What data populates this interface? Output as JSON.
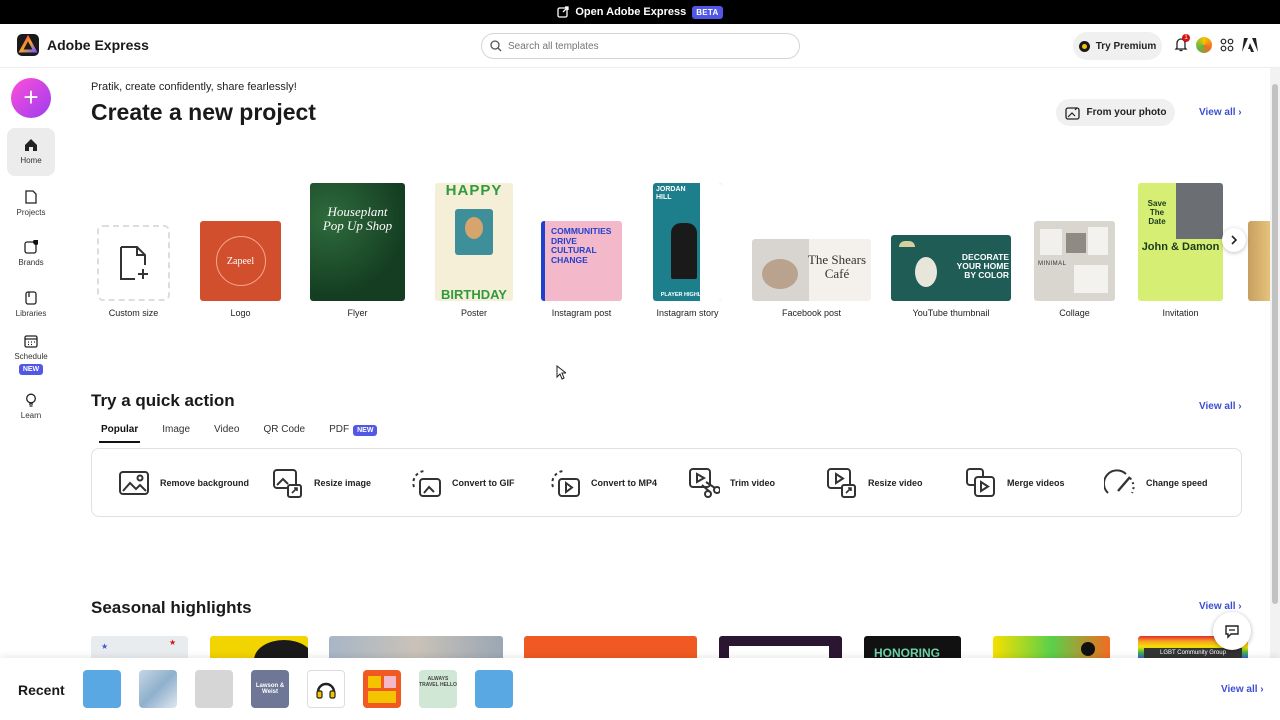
{
  "banner": {
    "text": "Open Adobe Express",
    "badge": "BETA"
  },
  "header": {
    "app_name": "Adobe Express",
    "search_placeholder": "Search all templates",
    "premium_label": "Try Premium",
    "notification_count": "1"
  },
  "sidebar": {
    "items": [
      {
        "label": "Home"
      },
      {
        "label": "Projects"
      },
      {
        "label": "Brands"
      },
      {
        "label": "Libraries"
      },
      {
        "label": "Schedule",
        "badge": "NEW"
      },
      {
        "label": "Learn"
      }
    ]
  },
  "main": {
    "greeting": "Pratik, create confidently, share fearlessly!",
    "title": "Create a new project",
    "from_photo_label": "From your photo",
    "view_all": "View all",
    "templates": [
      {
        "label": "Custom size"
      },
      {
        "label": "Logo",
        "thumb_text": "Zapeel"
      },
      {
        "label": "Flyer",
        "thumb_text": "Houseplant Pop Up Shop"
      },
      {
        "label": "Poster",
        "thumb_text_top": "HAPPY",
        "thumb_text_bottom": "BIRTHDAY"
      },
      {
        "label": "Instagram post",
        "thumb_text": "COMMUNITIES DRIVE CULTURAL CHANGE"
      },
      {
        "label": "Instagram story",
        "thumb_text": "JORDAN HILL",
        "thumb_text_bottom": "PLAYER HIGHLIGHT"
      },
      {
        "label": "Facebook post",
        "thumb_text": "The Shears Café"
      },
      {
        "label": "YouTube thumbnail",
        "thumb_text": "DECORATE YOUR HOME BY COLOR"
      },
      {
        "label": "Collage",
        "thumb_text": "MINIMAL"
      },
      {
        "label": "Invitation",
        "thumb_text_top": "Save The Date",
        "thumb_text": "John & Damon"
      }
    ]
  },
  "quick_actions": {
    "title": "Try a quick action",
    "view_all": "View all",
    "tabs": [
      {
        "label": "Popular"
      },
      {
        "label": "Image"
      },
      {
        "label": "Video"
      },
      {
        "label": "QR Code"
      },
      {
        "label": "PDF",
        "badge": "NEW"
      }
    ],
    "actions": [
      {
        "label": "Remove background",
        "icon": "remove-background-icon"
      },
      {
        "label": "Resize image",
        "icon": "resize-image-icon"
      },
      {
        "label": "Convert to GIF",
        "icon": "convert-gif-icon"
      },
      {
        "label": "Convert to MP4",
        "icon": "convert-mp4-icon"
      },
      {
        "label": "Trim video",
        "icon": "trim-video-icon"
      },
      {
        "label": "Resize video",
        "icon": "resize-video-icon"
      },
      {
        "label": "Merge videos",
        "icon": "merge-videos-icon"
      },
      {
        "label": "Change speed",
        "icon": "change-speed-icon"
      }
    ]
  },
  "seasonal": {
    "title": "Seasonal highlights",
    "view_all": "View all",
    "card_texts": [
      "HONORING",
      "LGBT Community Group"
    ]
  },
  "recent": {
    "title": "Recent",
    "view_all": "View all",
    "thumb_texts": [
      "Lawson & Weist",
      "ALWAYS TRAVEL HELLO"
    ]
  },
  "colors": {
    "accent": "#5258e4",
    "link": "#3d4ed6",
    "fab_start": "#ff4fd8",
    "fab_end": "#9b3df0"
  }
}
